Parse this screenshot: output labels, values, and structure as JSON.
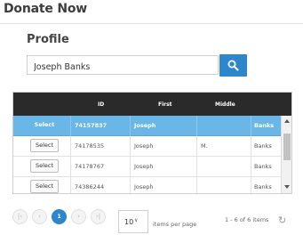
{
  "header": {
    "title": "Donate Now"
  },
  "profile": {
    "heading": "Profile",
    "search_value": "Joseph Banks",
    "search_icon": "search-icon"
  },
  "grid": {
    "columns": [
      "",
      "ID",
      "First",
      "Middle",
      ""
    ],
    "rows": [
      {
        "action": "Select",
        "id": "74157837",
        "first": "Joseph",
        "middle": "",
        "last": "Banks",
        "selected": true
      },
      {
        "action": "Select",
        "id": "74178535",
        "first": "Joseph",
        "middle": "M.",
        "last": "Banks",
        "selected": false
      },
      {
        "action": "Select",
        "id": "74178767",
        "first": "Joseph",
        "middle": "",
        "last": "Banks",
        "selected": false
      },
      {
        "action": "Select",
        "id": "74386244",
        "first": "Joseph",
        "middle": "",
        "last": "Banks",
        "selected": false
      }
    ]
  },
  "pager": {
    "first_icon": "first-page-icon",
    "prev_icon": "prev-page-icon",
    "current_page": "1",
    "next_icon": "next-page-icon",
    "last_icon": "last-page-icon",
    "page_size": "10",
    "page_size_label": "items per page",
    "info": "1 - 6 of 6 items",
    "refresh_icon": "refresh-icon"
  },
  "colors": {
    "accent": "#2e87cc",
    "selected_row": "#6ab6e6",
    "header_bg": "#2a2a2a"
  }
}
